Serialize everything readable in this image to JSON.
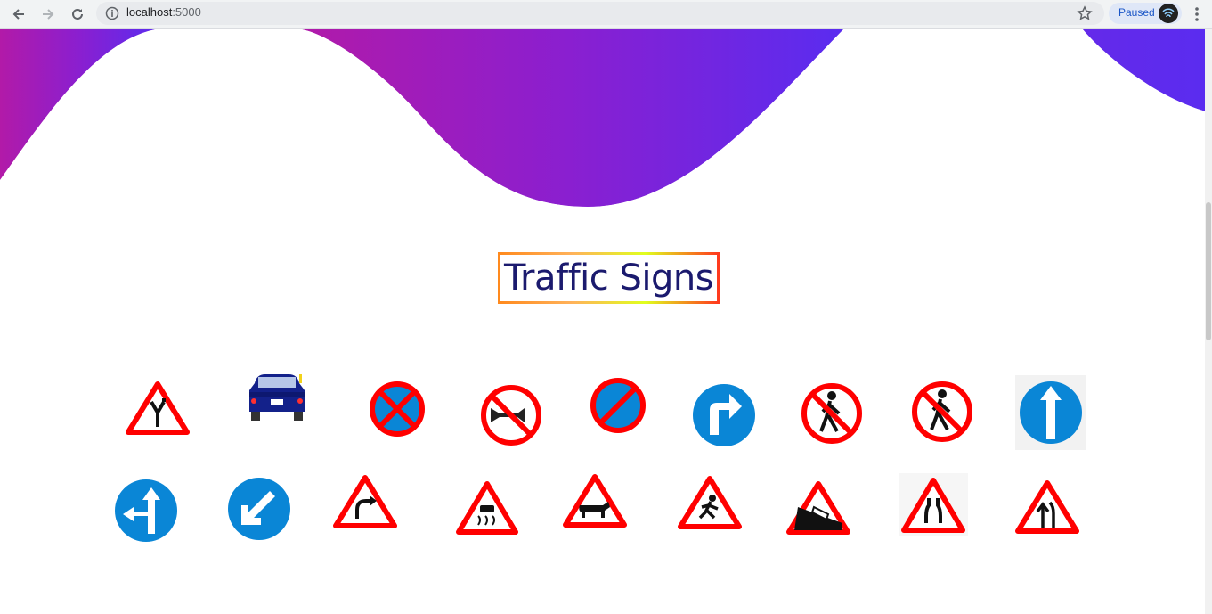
{
  "browser": {
    "url_host": "localhost",
    "url_port": ":5000",
    "paused_label": "Paused"
  },
  "page": {
    "title": "Traffic Signs"
  },
  "colors": {
    "wave_start": "#b21aa8",
    "wave_end": "#5a2cf0",
    "title_text": "#1b1a6e",
    "sign_red": "#ff0000",
    "sign_blue": "#0a86d6"
  },
  "signs_row1": [
    {
      "icon": "side-road-junction-icon"
    },
    {
      "icon": "car-rear-icon"
    },
    {
      "icon": "no-stopping-icon"
    },
    {
      "icon": "no-horn-icon"
    },
    {
      "icon": "no-parking-icon"
    },
    {
      "icon": "turn-right-icon"
    },
    {
      "icon": "no-pedestrians-icon"
    },
    {
      "icon": "no-pedestrians-icon"
    },
    {
      "icon": "straight-ahead-icon"
    }
  ],
  "signs_row2": [
    {
      "icon": "straight-or-left-icon"
    },
    {
      "icon": "keep-left-icon"
    },
    {
      "icon": "right-bend-icon"
    },
    {
      "icon": "slippery-road-icon"
    },
    {
      "icon": "cattle-icon"
    },
    {
      "icon": "children-icon"
    },
    {
      "icon": "steep-descent-icon"
    },
    {
      "icon": "narrow-bridge-icon"
    },
    {
      "icon": "lane-merge-icon"
    }
  ]
}
